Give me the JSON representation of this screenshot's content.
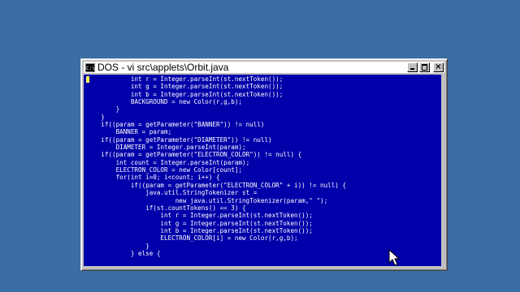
{
  "window": {
    "title": "DOS - vi src\\applets\\Orbit.java",
    "icon_label": "C:\\",
    "close_glyph": "×"
  },
  "editor": {
    "lines": [
      "            int r = Integer.parseInt(st.nextToken());",
      "            int g = Integer.parseInt(st.nextToken());",
      "            int b = Integer.parseInt(st.nextToken());",
      "            BACKGROUND = new Color(r,g,b);",
      "        }",
      "    }",
      "    if((param = getParameter(\"BANNER\")) != null)",
      "        BANNER = param;",
      "    if((param = getParameter(\"DIAMETER\")) != null)",
      "        DIAMETER = Integer.parseInt(param);",
      "    if((param = getParameter(\"ELECTRON_COLOR\")) != null) {",
      "        int count = Integer.parseInt(param);",
      "        ELECTRON_COLOR = new Color[count];",
      "        for(int i=0; i<count; i++) {",
      "            if((param = getParameter(\"ELECTRON_COLOR\" + i)) != null) {",
      "                java.util.StringTokenizer st =",
      "                        new java.util.StringTokenizer(param,\" \");",
      "                if(st.countTokens() == 3) {",
      "                    int r = Integer.parseInt(st.nextToken());",
      "                    int g = Integer.parseInt(st.nextToken());",
      "                    int b = Integer.parseInt(st.nextToken());",
      "                    ELECTRON_COLOR[i] = new Color(r,g,b);",
      "                }",
      "            } else {"
    ]
  },
  "colors": {
    "desktop": "#3a6ea5",
    "console_bg": "#0000aa",
    "console_fg": "#ffffff",
    "cursor": "#ffff55",
    "window_chrome": "#c0c0c0"
  },
  "icons": {
    "app": "dos-prompt-icon",
    "minimize": "minimize-icon",
    "maximize": "maximize-icon",
    "close": "close-icon",
    "pointer": "mouse-pointer-icon"
  }
}
